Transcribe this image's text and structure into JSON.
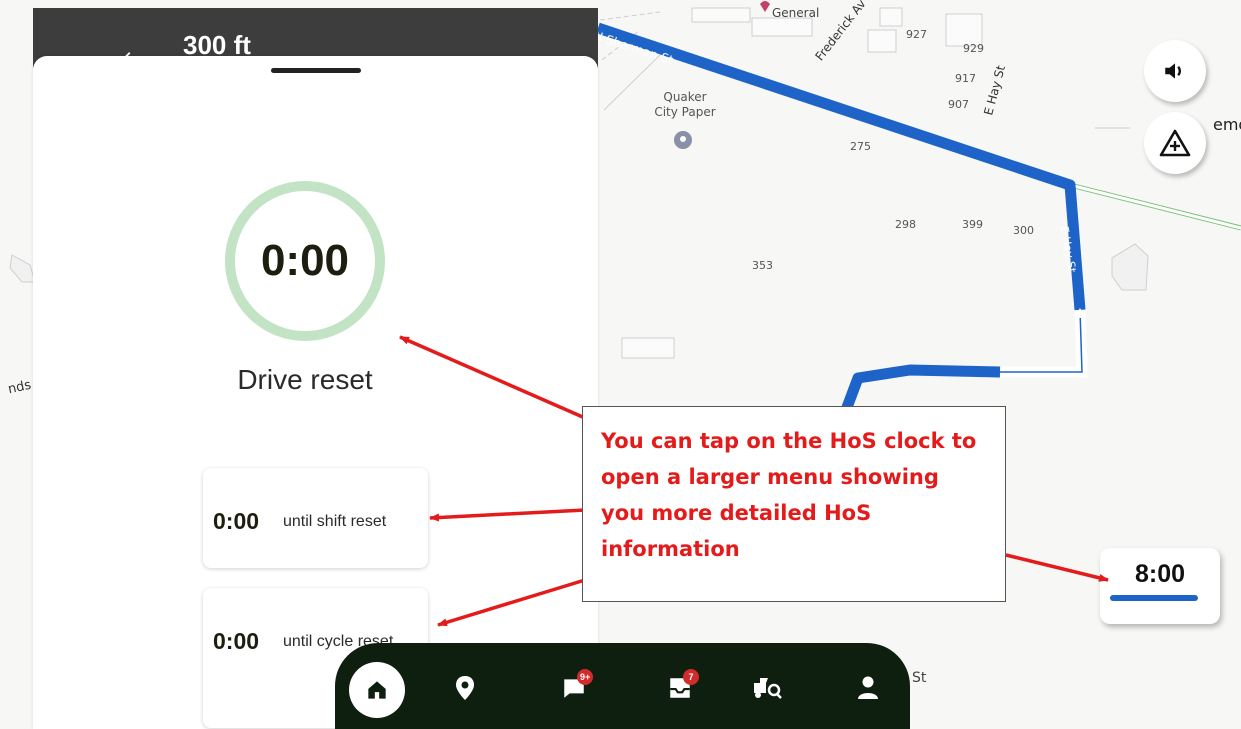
{
  "map": {
    "streets": {
      "sherman": "N Sherman St",
      "frederick": "Frederick Av",
      "e_hay_vertical": "E Hay St",
      "e_hay_route": "E Hay St",
      "bottom": "St"
    },
    "poi": {
      "general": "General",
      "quaker": "Quaker City Paper"
    },
    "numbers": [
      "927",
      "929",
      "917",
      "907",
      "275",
      "298",
      "399",
      "300",
      "353"
    ],
    "edge_left": "nds",
    "edge_right": "emo"
  },
  "banner": {
    "distance": "300 ft"
  },
  "hos_panel": {
    "drive_time": "0:00",
    "drive_label": "Drive reset",
    "shift": {
      "value": "0:00",
      "label": "until shift reset"
    },
    "cycle": {
      "value": "0:00",
      "label": "until cycle reset"
    }
  },
  "hos_clock": {
    "time": "8:00"
  },
  "bottom_nav": {
    "items": [
      {
        "name": "home",
        "icon": "home-icon"
      },
      {
        "name": "location",
        "icon": "location-pin-icon"
      },
      {
        "name": "messages",
        "icon": "chat-icon",
        "badge": "9+"
      },
      {
        "name": "inbox",
        "icon": "inbox-icon",
        "badge": "7"
      },
      {
        "name": "vehicle-inspection",
        "icon": "truck-search-icon"
      },
      {
        "name": "profile",
        "icon": "person-icon"
      }
    ]
  },
  "callout": {
    "text": "You can tap on the HoS clock to open a larger menu showing you more detailed HoS information"
  },
  "colors": {
    "route": "#1e64c8",
    "ring": "#c3e3c5",
    "nav_bg": "#0e1f10",
    "callout_text": "#e31b1b",
    "arrow": "#e31b1b",
    "badge": "#d12b2b"
  }
}
